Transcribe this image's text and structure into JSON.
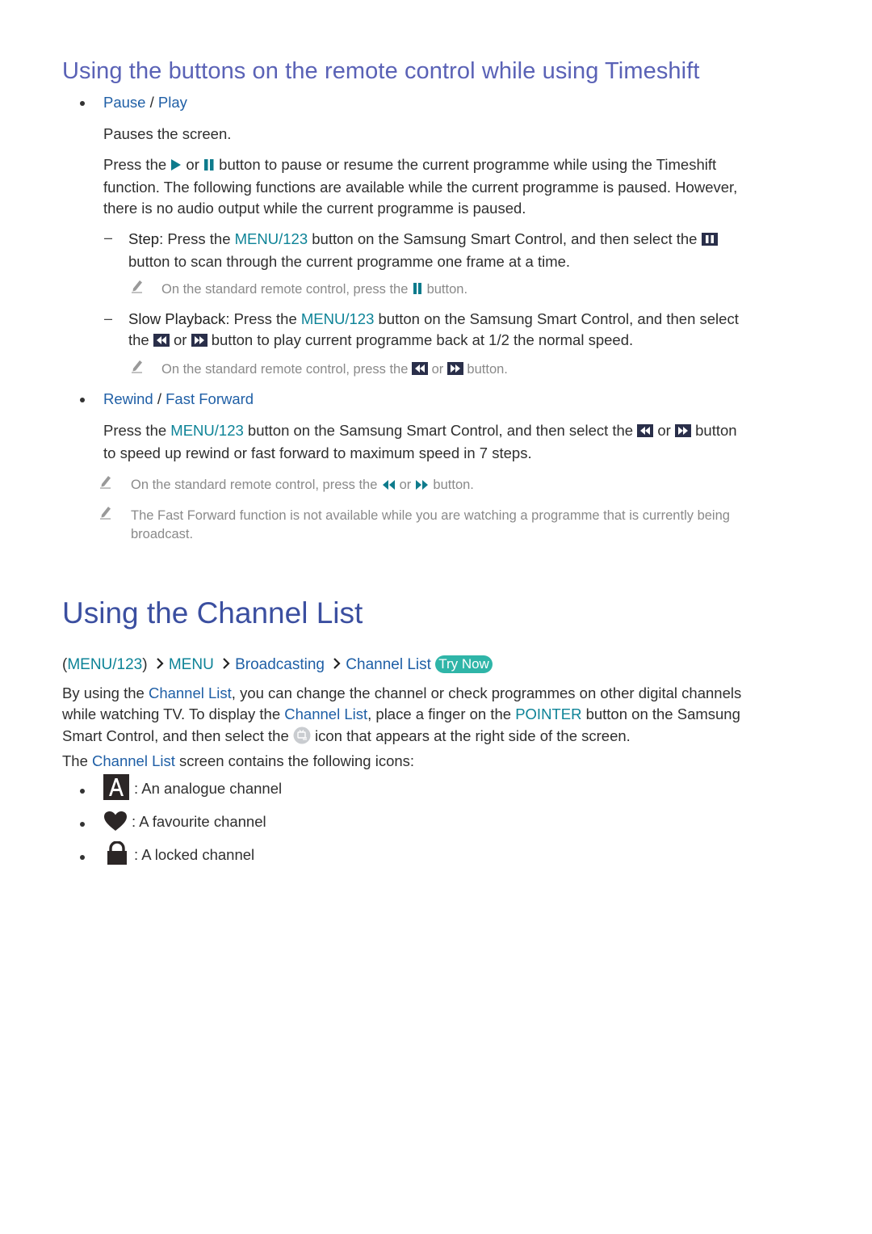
{
  "section_timeshift": {
    "heading": "Using the buttons on the remote control while using Timeshift",
    "pause_play": {
      "title_a": "Pause",
      "sep": " / ",
      "title_b": "Play",
      "desc": "Pauses the screen.",
      "para_pre": "Press the ",
      "para_or": " or ",
      "para_l1_post": " button to pause or resume the current programme while using the Timeshift",
      "para_l2": "function. The following functions are available while the current programme is paused. However,",
      "para_l3": "there is no audio output while the current programme is paused.",
      "step": {
        "label": "Step",
        "l1_a": ": Press the ",
        "menu": "MENU/123",
        "l1_b": " button on the Samsung Smart Control, and then select the ",
        "l2": "button to scan through the current programme one frame at a time.",
        "note_pre": "On the standard remote control, press the ",
        "note_post": " button."
      },
      "slow": {
        "label": "Slow Playback",
        "l1_a": ": Press the ",
        "menu": "MENU/123",
        "l1_b": " button on the Samsung Smart Control, and then select",
        "l2_pre": "the ",
        "l2_or": " or ",
        "l2_post": " button to play current programme back at 1/2 the normal speed.",
        "note_pre": "On the standard remote control, press the ",
        "note_or": " or ",
        "note_post": " button."
      }
    },
    "rewind_ff": {
      "title_a": "Rewind",
      "sep": " / ",
      "title_b": "Fast Forward",
      "l1_pre": "Press the ",
      "menu": "MENU/123",
      "l1_mid": " button on the Samsung Smart Control, and then select the ",
      "l1_or": " or ",
      "l1_post": " button",
      "l2": "to speed up rewind or fast forward to maximum speed in 7 steps.",
      "note1_pre": "On the standard remote control, press the ",
      "note1_or": " or ",
      "note1_post": " button.",
      "note2_l1": "The Fast Forward function is not available while you are watching a programme that is currently being",
      "note2_l2": "broadcast."
    }
  },
  "section_channel_list": {
    "heading": "Using the Channel List",
    "breadcrumb": {
      "open": "(",
      "item0": "MENU/123",
      "close": ")",
      "item1": "MENU",
      "item2": "Broadcasting",
      "item3": "Channel List",
      "try_now": "Try Now"
    },
    "para1": {
      "l1_pre": "By using the ",
      "l1_link": "Channel List",
      "l1_post": ", you can change the channel or check programmes on other digital channels",
      "l2_pre": "while watching TV. To display the ",
      "l2_link": "Channel List",
      "l2_mid": ", place a finger on the ",
      "l2_pointer": "POINTER",
      "l2_post": " button on the Samsung",
      "l3_pre": "Smart Control, and then select the ",
      "l3_post": " icon that appears at the right side of the screen."
    },
    "para2": {
      "pre": "The ",
      "link": "Channel List",
      "post": " screen contains the following icons:"
    },
    "legend": [
      {
        "icon": "analogue-A-icon",
        "label": ": An analogue channel"
      },
      {
        "icon": "heart-icon",
        "label": ": A favourite channel"
      },
      {
        "icon": "lock-icon",
        "label": ": A locked channel"
      }
    ]
  },
  "colors": {
    "subheading": "#5a62b6",
    "heading": "#3b4fa0",
    "link": "#1f5fa6",
    "menu_teal": "#0d8397",
    "try_now_bg": "#2fb5a8",
    "note_gray": "#8a8a8a"
  }
}
